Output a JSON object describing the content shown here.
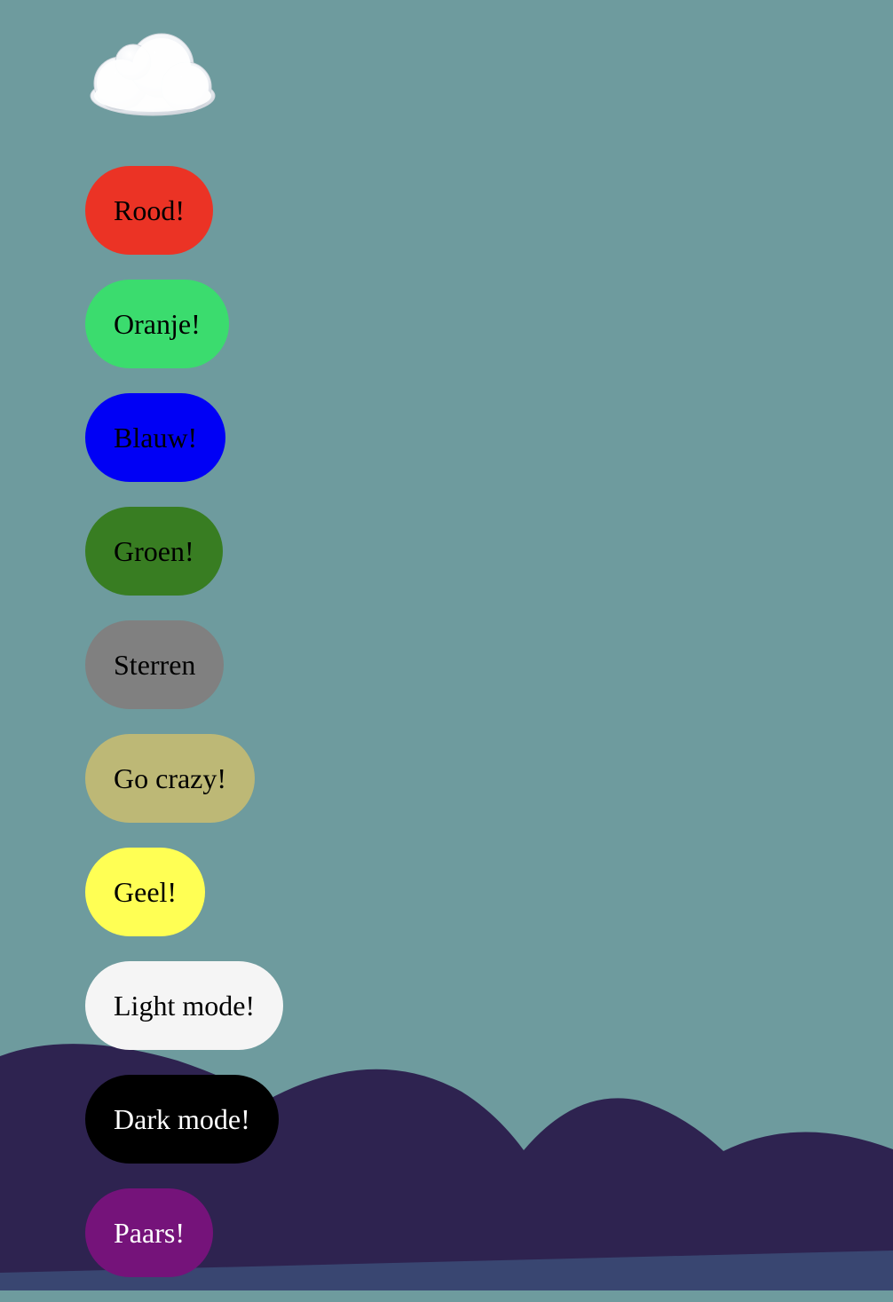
{
  "scene": {
    "background_color": "#6e9b9e",
    "hill_color": "#2e2350",
    "ground_color": "#394671"
  },
  "cloud": {
    "icon": "cloud-icon"
  },
  "buttons": [
    {
      "label": "Rood!",
      "color": "#eb3325"
    },
    {
      "label": "Oranje!",
      "color": "#3bdc6e"
    },
    {
      "label": "Blauw!",
      "color": "#0000f5"
    },
    {
      "label": "Groen!",
      "color": "#387d22"
    },
    {
      "label": "Sterren",
      "color": "#808080"
    },
    {
      "label": "Go crazy!",
      "color": "#bdb876"
    },
    {
      "label": "Geel!",
      "color": "#ffff54"
    },
    {
      "label": "Light mode!",
      "color": "#f5f5f5"
    },
    {
      "label": "Dark mode!",
      "color": "#000000"
    },
    {
      "label": "Paars!",
      "color": "#75137a"
    }
  ]
}
